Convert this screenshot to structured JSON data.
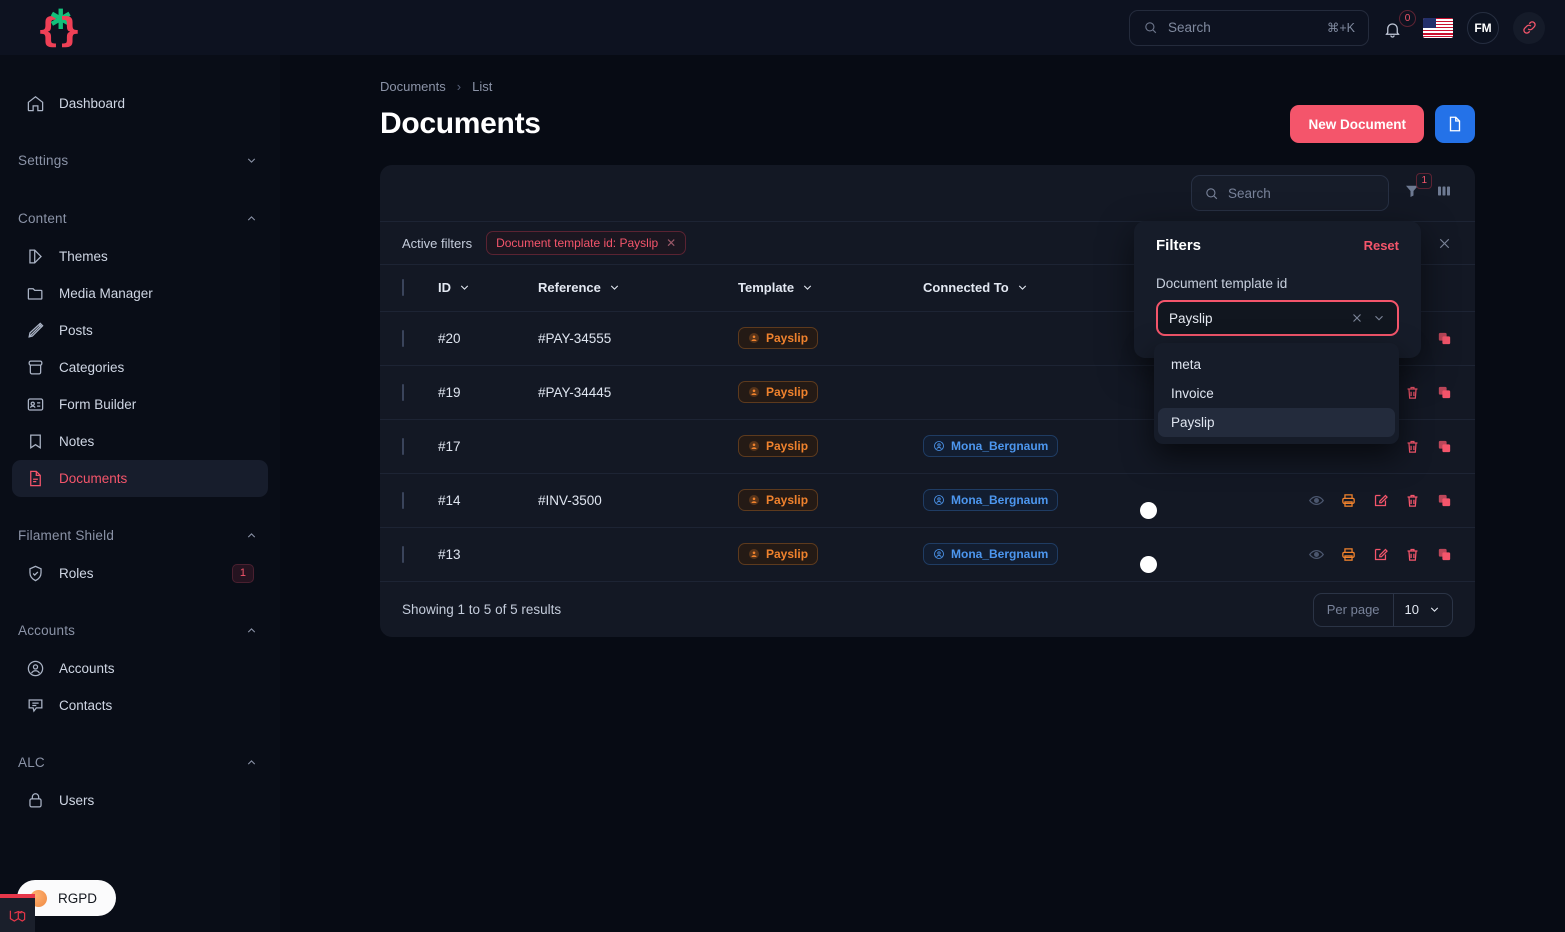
{
  "brand": {
    "logo": "curly-brace-star-logo"
  },
  "topbar": {
    "search_placeholder": "Search",
    "search_shortcut": "⌘+K",
    "notification_count": "0",
    "avatar_initials": "FM",
    "flag": "us-flag",
    "link_icon": "link-icon"
  },
  "sidebar": {
    "top_items": [
      {
        "label": "Dashboard",
        "icon": "home-icon"
      }
    ],
    "groups": [
      {
        "label": "Settings",
        "expanded": false,
        "items": []
      },
      {
        "label": "Content",
        "expanded": true,
        "items": [
          {
            "label": "Themes",
            "icon": "theme-icon"
          },
          {
            "label": "Media Manager",
            "icon": "folder-icon"
          },
          {
            "label": "Posts",
            "icon": "pencil-icon"
          },
          {
            "label": "Categories",
            "icon": "archive-icon"
          },
          {
            "label": "Form Builder",
            "icon": "id-card-icon"
          },
          {
            "label": "Notes",
            "icon": "bookmark-icon"
          },
          {
            "label": "Documents",
            "icon": "document-icon",
            "active": true
          }
        ]
      },
      {
        "label": "Filament Shield",
        "expanded": true,
        "items": [
          {
            "label": "Roles",
            "icon": "shield-check-icon",
            "badge": "1"
          }
        ]
      },
      {
        "label": "Accounts",
        "expanded": true,
        "items": [
          {
            "label": "Accounts",
            "icon": "user-circle-icon"
          },
          {
            "label": "Contacts",
            "icon": "chat-icon"
          }
        ]
      },
      {
        "label": "ALC",
        "expanded": true,
        "items": [
          {
            "label": "Users",
            "icon": "lock-icon"
          }
        ]
      }
    ],
    "rgpd_label": "RGPD"
  },
  "page": {
    "breadcrumb": [
      "Documents",
      "List"
    ],
    "breadcrumb_separator": "›",
    "title": "Documents",
    "new_button": "New Document",
    "doc_button_icon": "document-icon"
  },
  "table": {
    "search_placeholder": "Search",
    "filter_icon": "funnel-icon",
    "filter_badge": "1",
    "columns_icon": "columns-icon",
    "active_filters_label": "Active filters",
    "active_filter_chip": "Document template id: Payslip",
    "chip_remove": "✕",
    "clear_all_icon": "close-icon",
    "headers": [
      {
        "label": "ID",
        "sortable": true
      },
      {
        "label": "Reference",
        "sortable": true
      },
      {
        "label": "Template",
        "sortable": true
      },
      {
        "label": "Connected To",
        "sortable": true
      }
    ],
    "rows": [
      {
        "id": "#20",
        "reference": "#PAY-34555",
        "template": "Payslip",
        "connected_to": "",
        "toggle": null
      },
      {
        "id": "#19",
        "reference": "#PAY-34445",
        "template": "Payslip",
        "connected_to": "",
        "toggle": null
      },
      {
        "id": "#17",
        "reference": "",
        "template": "Payslip",
        "connected_to": "Mona_Bergnaum",
        "toggle": null
      },
      {
        "id": "#14",
        "reference": "#INV-3500",
        "template": "Payslip",
        "connected_to": "Mona_Bergnaum",
        "toggle": "off"
      },
      {
        "id": "#13",
        "reference": "",
        "template": "Payslip",
        "connected_to": "Mona_Bergnaum",
        "toggle": "off"
      }
    ],
    "row_actions": [
      "eye-icon",
      "printer-icon",
      "edit-icon",
      "trash-icon",
      "copy-icon"
    ],
    "footer": {
      "showing": "Showing 1 to 5 of 5 results",
      "per_page_label": "Per page",
      "per_page_value": "10"
    }
  },
  "filters_popover": {
    "title": "Filters",
    "reset": "Reset",
    "field_label": "Document template id",
    "selected_value": "Payslip",
    "clear_icon": "close-icon",
    "chevron_icon": "chevron-down-icon",
    "options": [
      "meta",
      "Invoice",
      "Payslip"
    ],
    "selected_option_index": 2
  },
  "colors": {
    "accent": "#f4556b",
    "blue": "#2472e8",
    "orange": "#f0822d",
    "background": "#070b14",
    "surface": "#131824"
  }
}
